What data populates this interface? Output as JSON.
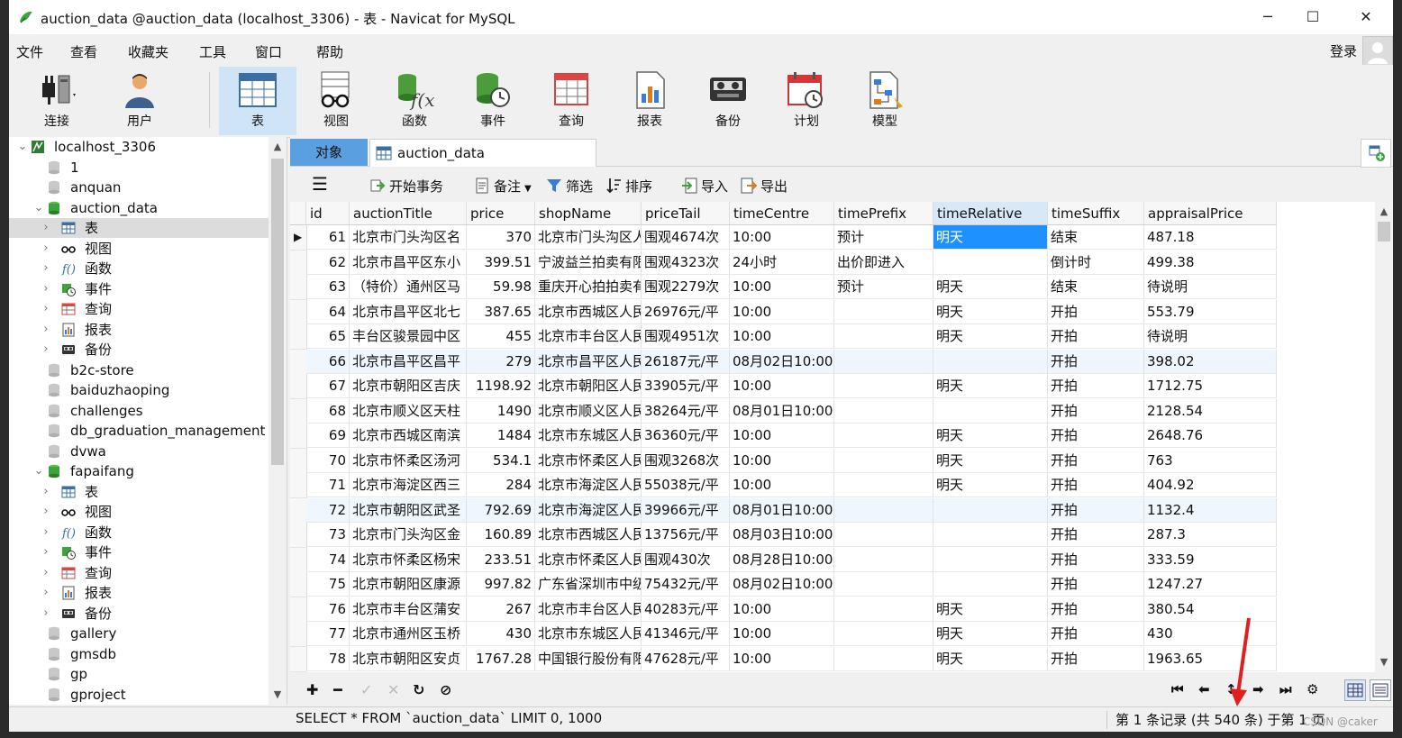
{
  "window": {
    "title": "auction_data @auction_data (localhost_3306) - 表 - Navicat for MySQL",
    "minimize": "─",
    "maximize": "☐",
    "close": "✕"
  },
  "menu": [
    "文件",
    "查看",
    "收藏夹",
    "工具",
    "窗口",
    "帮助"
  ],
  "login": "登录",
  "toolbar": [
    {
      "label": "连接",
      "icon": "plug-icon"
    },
    {
      "label": "用户",
      "icon": "user-icon"
    },
    {
      "label": "表",
      "icon": "table-icon",
      "active": true
    },
    {
      "label": "视图",
      "icon": "view-icon"
    },
    {
      "label": "函数",
      "icon": "function-icon"
    },
    {
      "label": "事件",
      "icon": "event-icon"
    },
    {
      "label": "查询",
      "icon": "query-icon"
    },
    {
      "label": "报表",
      "icon": "report-icon"
    },
    {
      "label": "备份",
      "icon": "backup-icon"
    },
    {
      "label": "计划",
      "icon": "schedule-icon"
    },
    {
      "label": "模型",
      "icon": "model-icon"
    }
  ],
  "tree": [
    {
      "label": "localhost_3306",
      "level": 0,
      "twisty": "v",
      "icon": "server"
    },
    {
      "label": "1",
      "level": 1,
      "twisty": "",
      "icon": "db-gray"
    },
    {
      "label": "anquan",
      "level": 1,
      "twisty": "",
      "icon": "db-gray"
    },
    {
      "label": "auction_data",
      "level": 1,
      "twisty": "v",
      "icon": "db-green"
    },
    {
      "label": "表",
      "level": 2,
      "twisty": ">",
      "icon": "table",
      "selected": true
    },
    {
      "label": "视图",
      "level": 2,
      "twisty": ">",
      "icon": "view"
    },
    {
      "label": "函数",
      "level": 2,
      "twisty": ">",
      "icon": "func"
    },
    {
      "label": "事件",
      "level": 2,
      "twisty": ">",
      "icon": "event"
    },
    {
      "label": "查询",
      "level": 2,
      "twisty": ">",
      "icon": "query"
    },
    {
      "label": "报表",
      "level": 2,
      "twisty": ">",
      "icon": "report"
    },
    {
      "label": "备份",
      "level": 2,
      "twisty": ">",
      "icon": "backup"
    },
    {
      "label": "b2c-store",
      "level": 1,
      "twisty": "",
      "icon": "db-gray"
    },
    {
      "label": "baiduzhaoping",
      "level": 1,
      "twisty": "",
      "icon": "db-gray"
    },
    {
      "label": "challenges",
      "level": 1,
      "twisty": "",
      "icon": "db-gray"
    },
    {
      "label": "db_graduation_management",
      "level": 1,
      "twisty": "",
      "icon": "db-gray"
    },
    {
      "label": "dvwa",
      "level": 1,
      "twisty": "",
      "icon": "db-gray"
    },
    {
      "label": "fapaifang",
      "level": 1,
      "twisty": "v",
      "icon": "db-green"
    },
    {
      "label": "表",
      "level": 2,
      "twisty": ">",
      "icon": "table"
    },
    {
      "label": "视图",
      "level": 2,
      "twisty": ">",
      "icon": "view"
    },
    {
      "label": "函数",
      "level": 2,
      "twisty": ">",
      "icon": "func"
    },
    {
      "label": "事件",
      "level": 2,
      "twisty": ">",
      "icon": "event"
    },
    {
      "label": "查询",
      "level": 2,
      "twisty": ">",
      "icon": "query"
    },
    {
      "label": "报表",
      "level": 2,
      "twisty": ">",
      "icon": "report"
    },
    {
      "label": "备份",
      "level": 2,
      "twisty": ">",
      "icon": "backup"
    },
    {
      "label": "gallery",
      "level": 1,
      "twisty": "",
      "icon": "db-gray"
    },
    {
      "label": "gmsdb",
      "level": 1,
      "twisty": "",
      "icon": "db-gray"
    },
    {
      "label": "gp",
      "level": 1,
      "twisty": "",
      "icon": "db-gray"
    },
    {
      "label": "gproject",
      "level": 1,
      "twisty": "",
      "icon": "db-gray"
    }
  ],
  "tabs": {
    "objects": "对象",
    "doc": "auction_data @auction_data..."
  },
  "actions": [
    "开始事务",
    "备注",
    "筛选",
    "排序",
    "导入",
    "导出"
  ],
  "columns": [
    "id",
    "auctionTitle",
    "price",
    "shopName",
    "priceTail",
    "timeCentre",
    "timePrefix",
    "timeRelative",
    "timeSuffix",
    "appraisalPrice"
  ],
  "rows": [
    [
      "61",
      "北京市门头沟区名",
      "370",
      "北京市门头沟区人",
      "围观4674次",
      "10:00",
      "预计",
      "明天",
      "结束",
      "487.18"
    ],
    [
      "62",
      "北京市昌平区东小",
      "399.51",
      "宁波益兰拍卖有限",
      "围观4323次",
      "24小时",
      "出价即进入",
      "",
      "倒计时",
      "499.38"
    ],
    [
      "63",
      "（特价）通州区马",
      "59.98",
      "重庆开心拍拍卖有",
      "围观2279次",
      "10:00",
      "预计",
      "明天",
      "结束",
      "待说明"
    ],
    [
      "64",
      "北京市昌平区北七",
      "387.65",
      "北京市西城区人民",
      "26976元/平",
      "10:00",
      "",
      "明天",
      "开拍",
      "553.79"
    ],
    [
      "65",
      "丰台区骏景园中区",
      "455",
      "北京市丰台区人民",
      "围观4951次",
      "10:00",
      "",
      "明天",
      "开拍",
      "待说明"
    ],
    [
      "66",
      "北京市昌平区昌平",
      "279",
      "北京市昌平区人民",
      "26187元/平",
      "08月02日10:00",
      "",
      "",
      "开拍",
      "398.02"
    ],
    [
      "67",
      "北京市朝阳区吉庆",
      "1198.92",
      "北京市朝阳区人民",
      "33905元/平",
      "10:00",
      "",
      "明天",
      "开拍",
      "1712.75"
    ],
    [
      "68",
      "北京市顺义区天柱",
      "1490",
      "北京市顺义区人民",
      "38264元/平",
      "08月01日10:00",
      "",
      "",
      "开拍",
      "2128.54"
    ],
    [
      "69",
      "北京市西城区南滨",
      "1484",
      "北京市东城区人民",
      "36360元/平",
      "10:00",
      "",
      "明天",
      "开拍",
      "2648.76"
    ],
    [
      "70",
      "北京市怀柔区汤河",
      "534.1",
      "北京市怀柔区人民",
      "围观3268次",
      "10:00",
      "",
      "明天",
      "开拍",
      "763"
    ],
    [
      "71",
      "北京市海淀区西三",
      "284",
      "北京市海淀区人民",
      "55038元/平",
      "10:00",
      "",
      "明天",
      "开拍",
      "404.92"
    ],
    [
      "72",
      "北京市朝阳区武圣",
      "792.69",
      "北京市海淀区人民",
      "39966元/平",
      "08月01日10:00",
      "",
      "",
      "开拍",
      "1132.4"
    ],
    [
      "73",
      "北京市门头沟区金",
      "160.89",
      "北京市西城区人民",
      "13756元/平",
      "08月03日10:00",
      "",
      "",
      "开拍",
      "287.3"
    ],
    [
      "74",
      "北京市怀柔区杨宋",
      "233.51",
      "北京市怀柔区人民",
      "围观430次",
      "08月28日10:00",
      "",
      "",
      "开拍",
      "333.59"
    ],
    [
      "75",
      "北京市朝阳区康源",
      "997.82",
      "广东省深圳市中级",
      "75432元/平",
      "08月02日10:00",
      "",
      "",
      "开拍",
      "1247.27"
    ],
    [
      "76",
      "北京市丰台区蒲安",
      "267",
      "北京市丰台区人民",
      "40283元/平",
      "10:00",
      "",
      "明天",
      "开拍",
      "380.54"
    ],
    [
      "77",
      "北京市通州区玉桥",
      "430",
      "北京市东城区人民",
      "41346元/平",
      "10:00",
      "",
      "明天",
      "开拍",
      "430"
    ],
    [
      "78",
      "北京市朝阳区安贞",
      "1767.28",
      "中国银行股份有限",
      "47628元/平",
      "10:00",
      "",
      "明天",
      "开拍",
      "1963.65"
    ]
  ],
  "status": {
    "sql": "SELECT * FROM `auction_data` LIMIT 0, 1000",
    "records": "第 1 条记录 (共 540 条) 于第 1 页"
  },
  "watermark": "CSDN @caker",
  "colors": {
    "accent": "#1e90ff",
    "tab_active": "#5aa0e0",
    "toolbar_active": "#cfe4f7",
    "db_green": "#3aa53a",
    "annotation_red": "#e02020"
  }
}
